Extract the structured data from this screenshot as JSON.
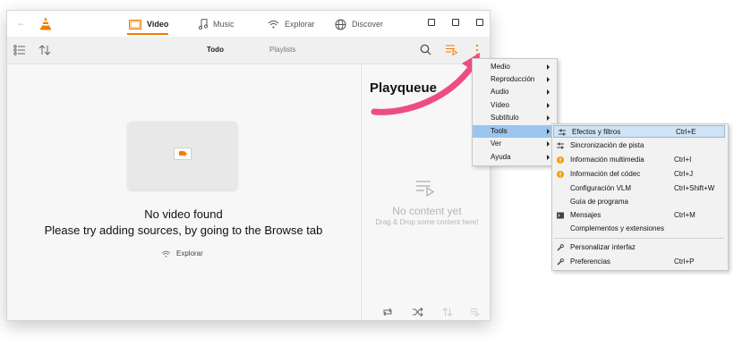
{
  "titlebar": {
    "tabs": [
      {
        "label": "Video",
        "icon": "video-icon"
      },
      {
        "label": "Music",
        "icon": "music-icon"
      },
      {
        "label": "Explorar",
        "icon": "wifi-icon"
      },
      {
        "label": "Discover",
        "icon": "globe-icon"
      }
    ]
  },
  "toolbar": {
    "filter_all": "Todo",
    "filter_playlists": "Playlists"
  },
  "main": {
    "empty_title": "No video found",
    "empty_hint": "Please try adding sources, by going to the Browse tab",
    "explorar_link": "Explorar"
  },
  "playqueue": {
    "empty_title": "No content yet",
    "empty_hint": "Drag & Drop some content here!"
  },
  "callout": {
    "label": "Playqueue",
    "arrow_color": "#ee4d84"
  },
  "menu": {
    "items": [
      "Medio",
      "Reproducción",
      "Audio",
      "Vídeo",
      "Subtítulo",
      "Tools",
      "Ver",
      "Ayuda"
    ],
    "active": "Tools"
  },
  "submenu": {
    "items": [
      {
        "label": "Efectos y filtros",
        "shortcut": "Ctrl+E",
        "icon": "sliders-icon"
      },
      {
        "label": "Sincronización de pista",
        "shortcut": "",
        "icon": "sliders-icon"
      },
      {
        "label": "Información multimedia",
        "shortcut": "Ctrl+I",
        "icon": "warning-icon"
      },
      {
        "label": "Información del códec",
        "shortcut": "Ctrl+J",
        "icon": "warning-icon"
      },
      {
        "label": "Configuración VLM",
        "shortcut": "Ctrl+Shift+W",
        "icon": ""
      },
      {
        "label": "Guía de programa",
        "shortcut": "",
        "icon": ""
      },
      {
        "label": "Mensajes",
        "shortcut": "Ctrl+M",
        "icon": "terminal-icon"
      },
      {
        "label": "Complementos y extensiones",
        "shortcut": "",
        "icon": ""
      },
      {
        "label": "Personalizar interfaz",
        "shortcut": "",
        "icon": "wrench-icon"
      },
      {
        "label": "Preferencias",
        "shortcut": "Ctrl+P",
        "icon": "wrench-icon"
      }
    ]
  },
  "colors": {
    "accent": "#f07d00",
    "menu_highlight": "#9bc5ee",
    "callout_arrow": "#ee4d84"
  }
}
